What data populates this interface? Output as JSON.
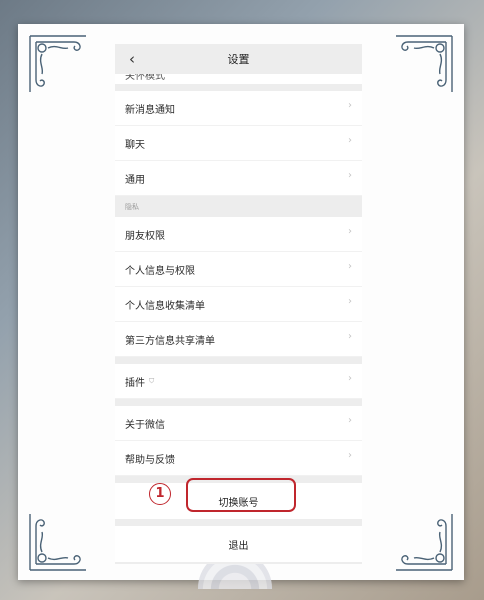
{
  "nav": {
    "title": "设置",
    "back_icon": "‹"
  },
  "cut_item_label": "关怀模式",
  "groups": [
    {
      "items": [
        "新消息通知",
        "聊天",
        "通用"
      ]
    },
    {
      "header": "隐私",
      "items": [
        "朋友权限",
        "个人信息与权限",
        "个人信息收集清单",
        "第三方信息共享清单"
      ]
    },
    {
      "items": [
        "插件"
      ]
    },
    {
      "items": [
        "关于微信",
        "帮助与反馈"
      ]
    }
  ],
  "switch_account": "切换账号",
  "logout": "退出",
  "step_number": "1",
  "chevron_icon": "›",
  "accent_color": "#c0262d"
}
